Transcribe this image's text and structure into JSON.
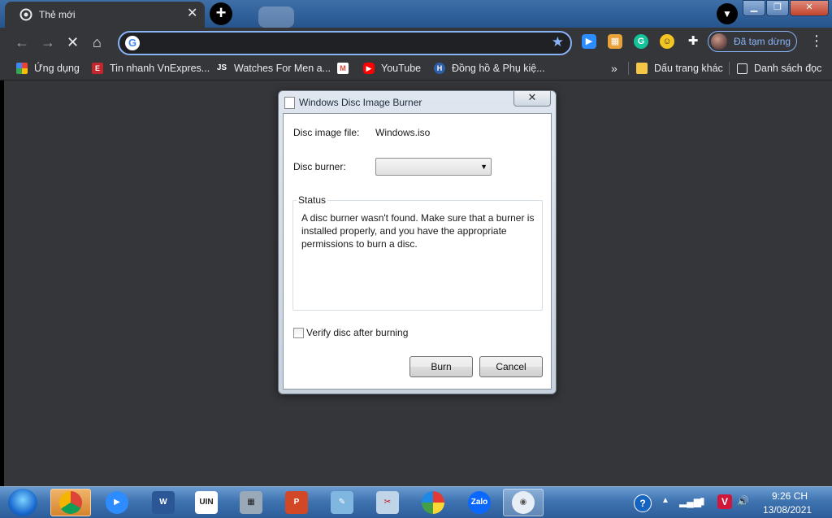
{
  "browser": {
    "tab_title": "Thẻ mới",
    "new_tab": "+",
    "profile_label": "Đã tạm dừng",
    "omnibox_placeholder": ""
  },
  "bookmarks": {
    "apps": "Ứng dụng",
    "items": [
      "Tin nhanh VnExpres...",
      "Watches For Men a...",
      "YouTube",
      "Đồng hồ & Phụ kiệ..."
    ],
    "js_badge": "JS",
    "more": "»",
    "other_bookmarks": "Dấu trang khác",
    "reading_list": "Danh sách đọc"
  },
  "dialog": {
    "title": "Windows Disc Image Burner",
    "close": "✕",
    "disc_image_label": "Disc image file:",
    "disc_image_value": "Windows.iso",
    "disc_burner_label": "Disc burner:",
    "disc_burner_value": "",
    "status_legend": "Status",
    "status_message": "A disc burner wasn't found. Make sure that a burner is installed properly, and you have the appropriate permissions to burn a disc.",
    "verify_label": "Verify disc after burning",
    "verify_checked": false,
    "burn_button": "Burn",
    "cancel_button": "Cancel"
  },
  "taskbar": {
    "zalo_label": "Zalo",
    "clock_time": "9:26 CH",
    "clock_date": "13/08/2021"
  }
}
